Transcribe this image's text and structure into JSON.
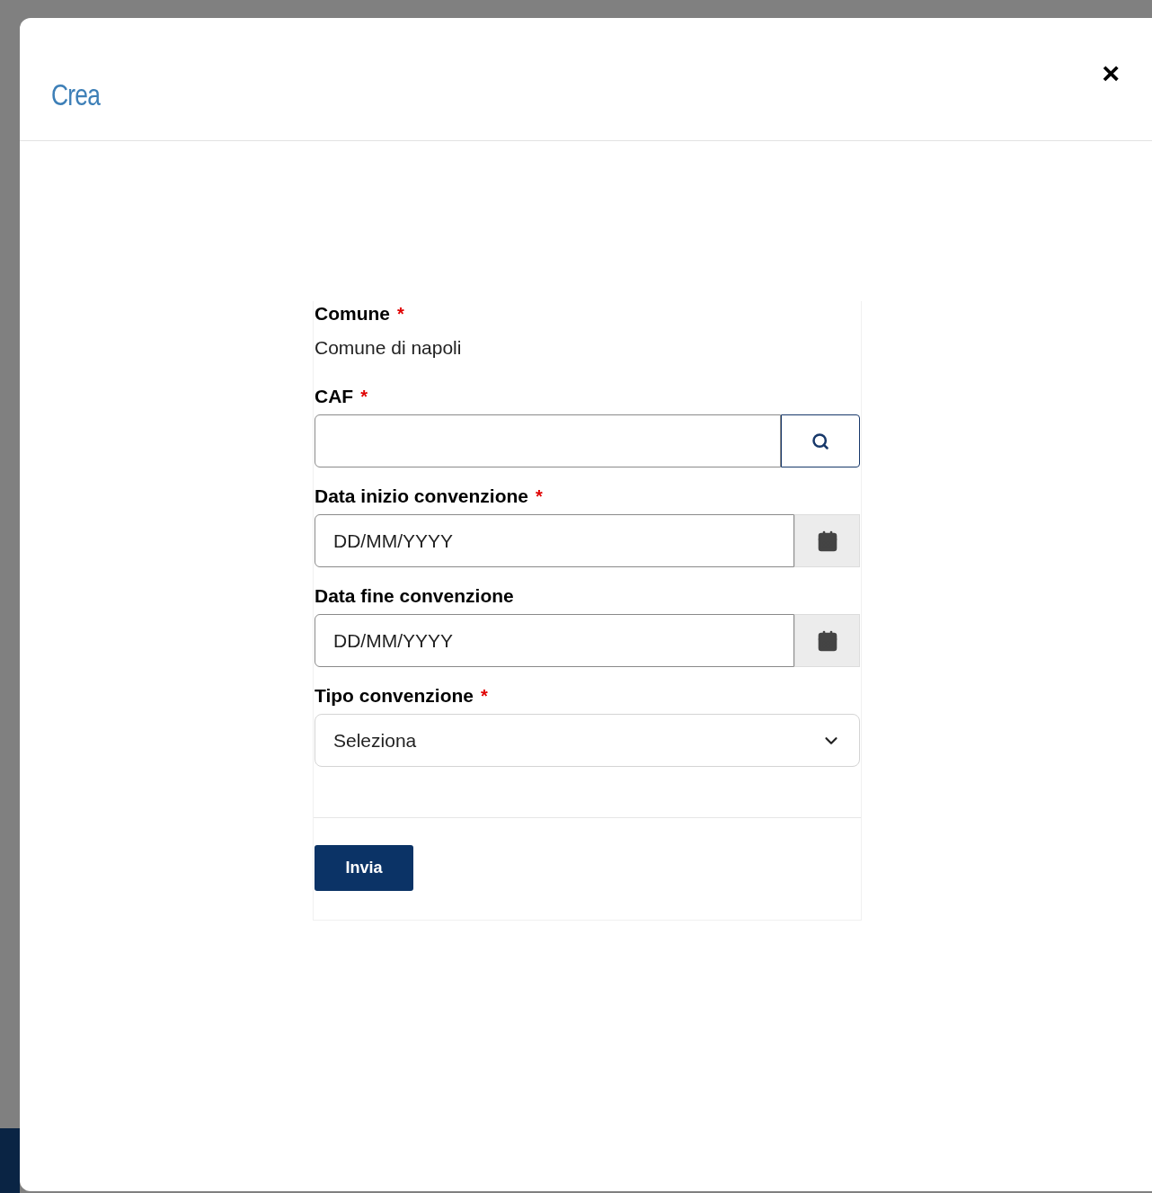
{
  "dialog": {
    "title": "Crea",
    "close": "×"
  },
  "form": {
    "fields": [
      {
        "kind": "static",
        "label": "Comune",
        "required_mark": "*",
        "value": "Comune di napoli"
      },
      {
        "kind": "search",
        "label": "CAF",
        "required_mark": "*"
      },
      {
        "kind": "date",
        "label": "Data inizio convenzione",
        "required_mark": "*",
        "placeholder": "DD/MM/YYYY"
      },
      {
        "kind": "date",
        "label": "Data fine convenzione",
        "placeholder": "DD/MM/YYYY"
      },
      {
        "kind": "select",
        "label": "Tipo convenzione",
        "required_mark": "*",
        "value": "Seleziona"
      }
    ],
    "submit": "Invia"
  }
}
